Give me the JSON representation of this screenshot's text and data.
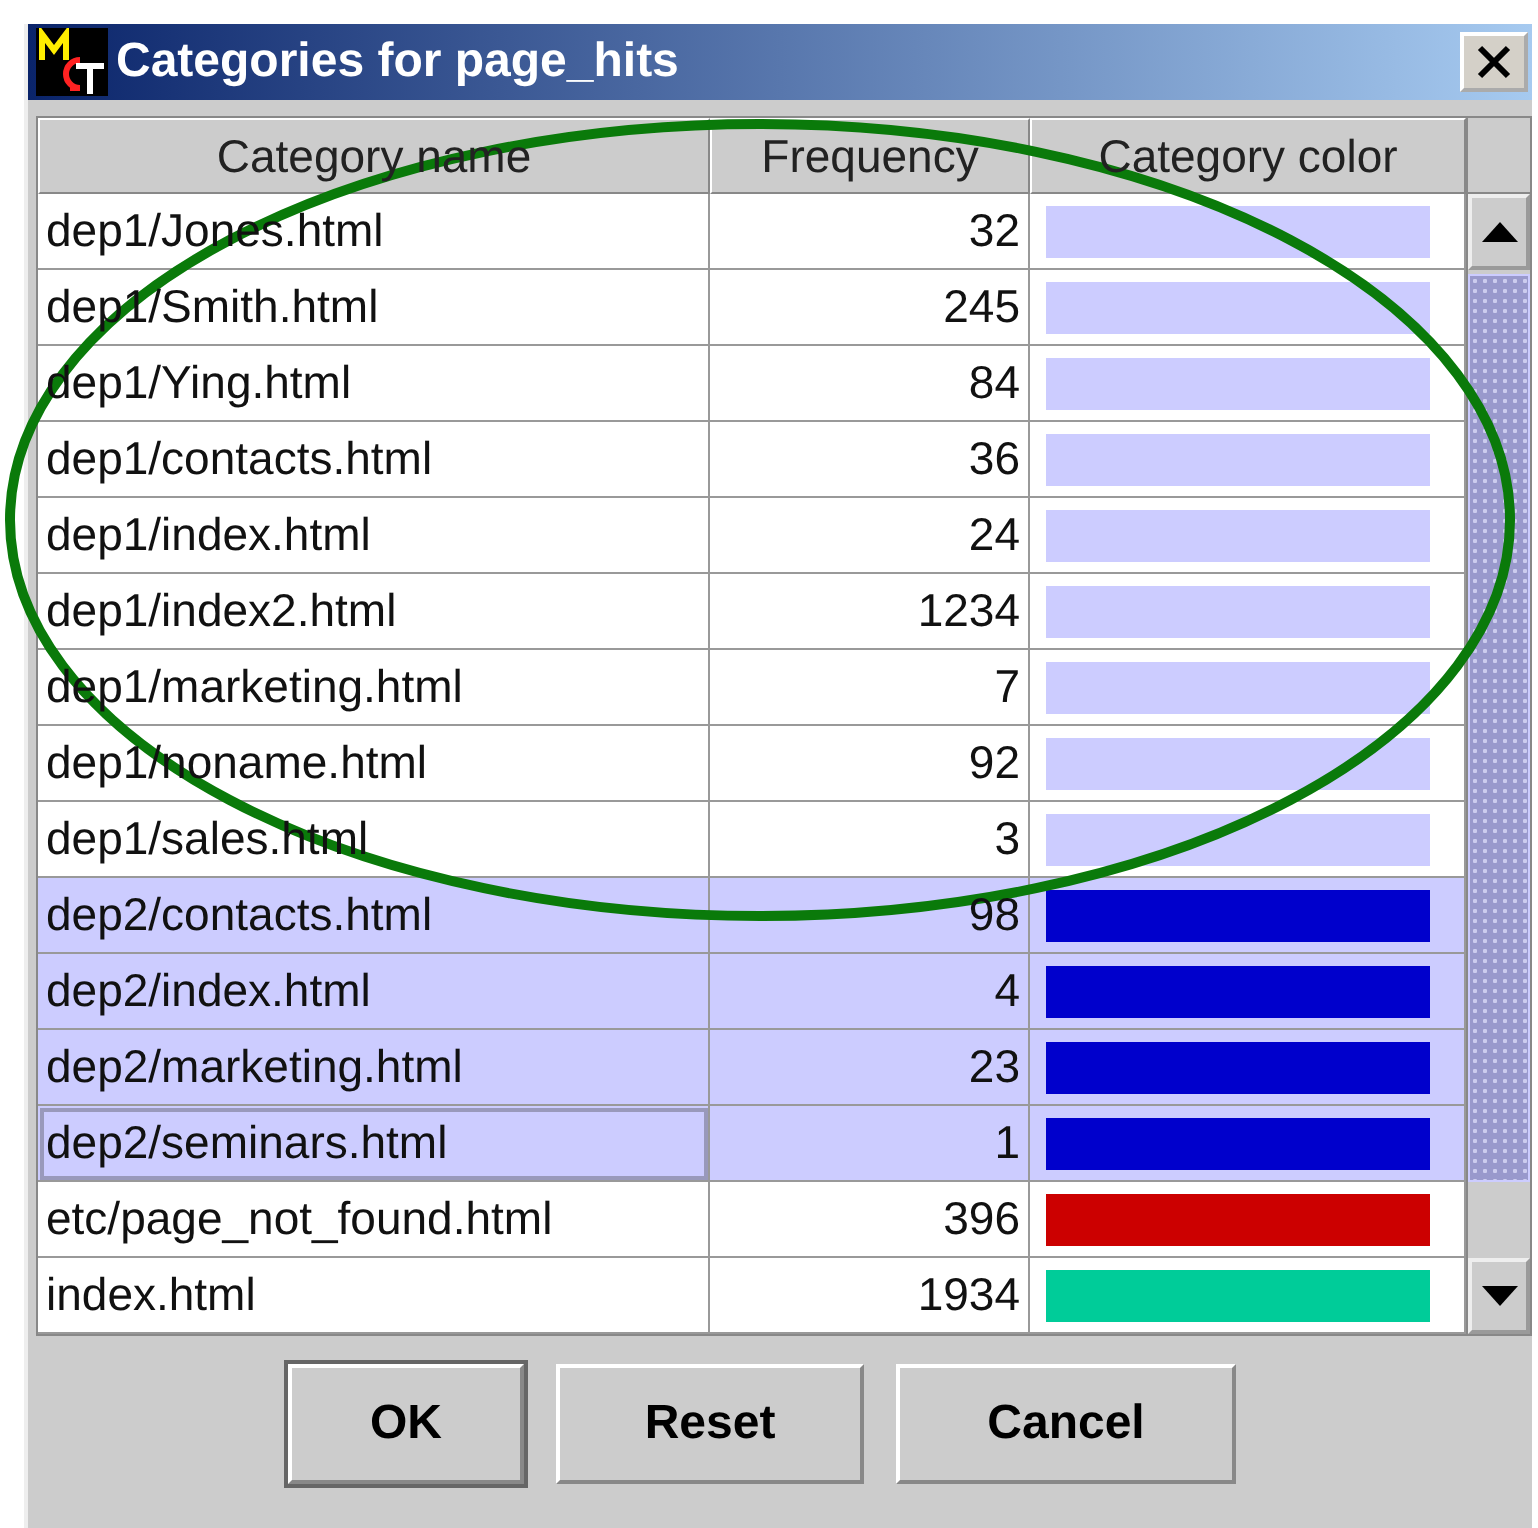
{
  "window": {
    "title": "Categories for page_hits"
  },
  "table": {
    "columns": [
      "Category name",
      "Frequency",
      "Category color"
    ],
    "rows": [
      {
        "name": "dep1/Jones.html",
        "frequency": "32",
        "color": "#ccccff",
        "selected": false
      },
      {
        "name": "dep1/Smith.html",
        "frequency": "245",
        "color": "#ccccff",
        "selected": false
      },
      {
        "name": "dep1/Ying.html",
        "frequency": "84",
        "color": "#ccccff",
        "selected": false
      },
      {
        "name": "dep1/contacts.html",
        "frequency": "36",
        "color": "#ccccff",
        "selected": false
      },
      {
        "name": "dep1/index.html",
        "frequency": "24",
        "color": "#ccccff",
        "selected": false
      },
      {
        "name": "dep1/index2.html",
        "frequency": "1234",
        "color": "#ccccff",
        "selected": false
      },
      {
        "name": "dep1/marketing.html",
        "frequency": "7",
        "color": "#ccccff",
        "selected": false
      },
      {
        "name": "dep1/noname.html",
        "frequency": "92",
        "color": "#ccccff",
        "selected": false
      },
      {
        "name": "dep1/sales.html",
        "frequency": "3",
        "color": "#ccccff",
        "selected": false
      },
      {
        "name": "dep2/contacts.html",
        "frequency": "98",
        "color": "#0000cc",
        "selected": true
      },
      {
        "name": "dep2/index.html",
        "frequency": "4",
        "color": "#0000cc",
        "selected": true
      },
      {
        "name": "dep2/marketing.html",
        "frequency": "23",
        "color": "#0000cc",
        "selected": true
      },
      {
        "name": "dep2/seminars.html",
        "frequency": "1",
        "color": "#0000cc",
        "selected": true
      },
      {
        "name": "etc/page_not_found.html",
        "frequency": "396",
        "color": "#cc0000",
        "selected": false
      },
      {
        "name": "index.html",
        "frequency": "1934",
        "color": "#00cc99",
        "selected": false
      }
    ]
  },
  "buttons": [
    {
      "label": "OK",
      "default": true
    },
    {
      "label": "Reset",
      "default": false
    },
    {
      "label": "Cancel",
      "default": false
    }
  ]
}
